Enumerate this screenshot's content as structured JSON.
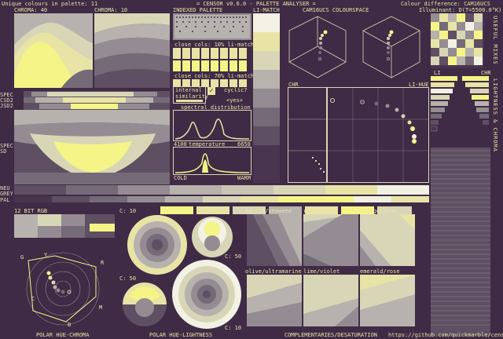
{
  "header": {
    "unique_colours": "Unique colours in palette: 11",
    "app_title": "= CENSOR v0.6.0 - PALETTE ANALYSER =",
    "colour_difference": "Colour difference: CAM16UCS",
    "illuminant": "Illuminant: D(T=5500.0°K)"
  },
  "labels": {
    "chroma_40": "CHROMA: 40",
    "chroma_10": "CHROMA: 10",
    "indexed_palette": "INDEXED PALETTE",
    "li_match": "LI-MATCH",
    "cam16ucs_colourspace": "CAM16UCS COLOURSPACE",
    "useful_mixes": "USEFUL MIXES",
    "lightness_chroma": "LIGHTNESS & CHROMA",
    "li": "LI",
    "chr_right": "CHR",
    "chr_left": "CHR",
    "li_hue": "LI-HUE",
    "close_cols_10": "close cols: 10% li-match",
    "close_cols_70": "close cols: 70% li-match",
    "internal_similarity": "internal similarity",
    "cyclic": "cyclic?",
    "yes": "<yes>",
    "spectral_distribution": "spectral distribution",
    "nm_4100": "4100",
    "nm_6650": "6650",
    "temperature": "temperature",
    "cold": "COLD",
    "warm": "WARM",
    "spec": "SPEC",
    "csd": "CSD2",
    "jsd": "JSD2",
    "spec2": "SPEC",
    "sd": "SD",
    "neu": "NEU",
    "grey": "GREY",
    "pal": "PAL",
    "bit_rgb": "12 BIT RGB",
    "c10_top": "C: 10",
    "c50_mid": "C: 50",
    "c50_bot": "C: 50",
    "c10_bot": "C: 10",
    "purple_seaweed": "purple/seaweed",
    "red_cyan": "red/cyan",
    "orange_blue": "orange/blue",
    "olive_ultramarine": "olive/ultramarine",
    "lime_violet": "lime/violet",
    "emerald_rose": "emerald/rose",
    "polar_hue_chroma": "POLAR HUE-CHROMA",
    "polar_hue_lightness": "POLAR HUE-LIGHTNESS",
    "complementaries": "COMPLEMENTARIES/DESATURATION",
    "github": "https://github.com/quickmarble/censor",
    "hex_g": "G",
    "hex_y": "Y",
    "hex_r": "R",
    "hex_c": "C",
    "hex_m": "M",
    "hex_b": "B"
  },
  "colors": {
    "bg": "#3f2b45",
    "fg": "#e7e4a6",
    "yellow": "#f4f487",
    "lt_yellow": "#e7e4a6",
    "pale": "#d8d6b6",
    "grey1": "#b7b2ad",
    "grey2": "#948c92",
    "grey3": "#756b78",
    "grey4": "#5e4f62",
    "white": "#f2f1e4",
    "purple": "#4a3550"
  }
}
